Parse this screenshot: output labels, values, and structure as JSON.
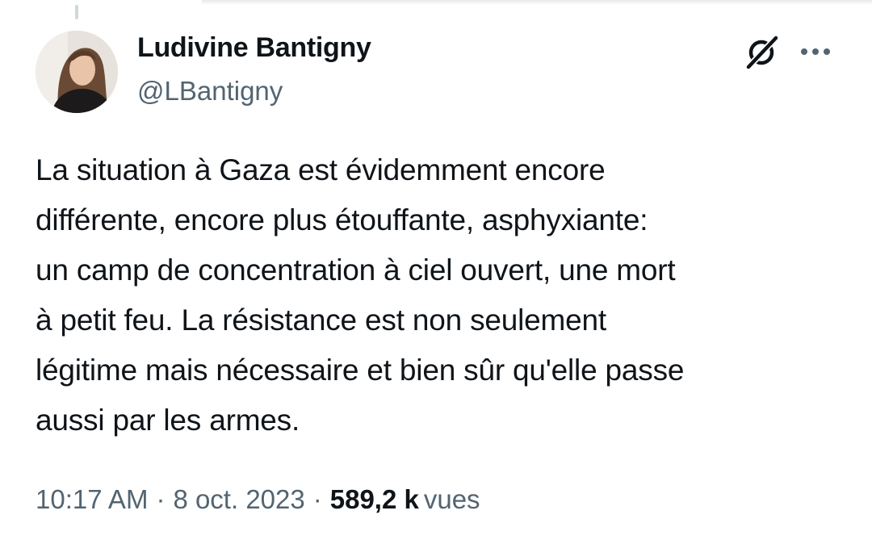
{
  "tweet": {
    "author": {
      "display_name": "Ludivine Bantigny",
      "handle": "@LBantigny"
    },
    "text": "La situation à Gaza est évidemment encore\ndifférente, encore plus étouffante, asphyxiante:\nun camp de concentration à ciel ouvert, une mort\nà petit feu. La résistance est non seulement\nlégitime mais nécessaire et bien sûr qu'elle passe\naussi par les armes.",
    "time": "10:17 AM",
    "date": "8 oct. 2023",
    "separator": "·",
    "views_count": "589,2 k",
    "views_label": "vues"
  },
  "icons": {
    "grok": "grok-icon",
    "more": "more-icon",
    "avatar": "avatar"
  },
  "colors": {
    "text": "#0f1419",
    "secondary": "#536471",
    "thread_line": "#cfd9de"
  }
}
